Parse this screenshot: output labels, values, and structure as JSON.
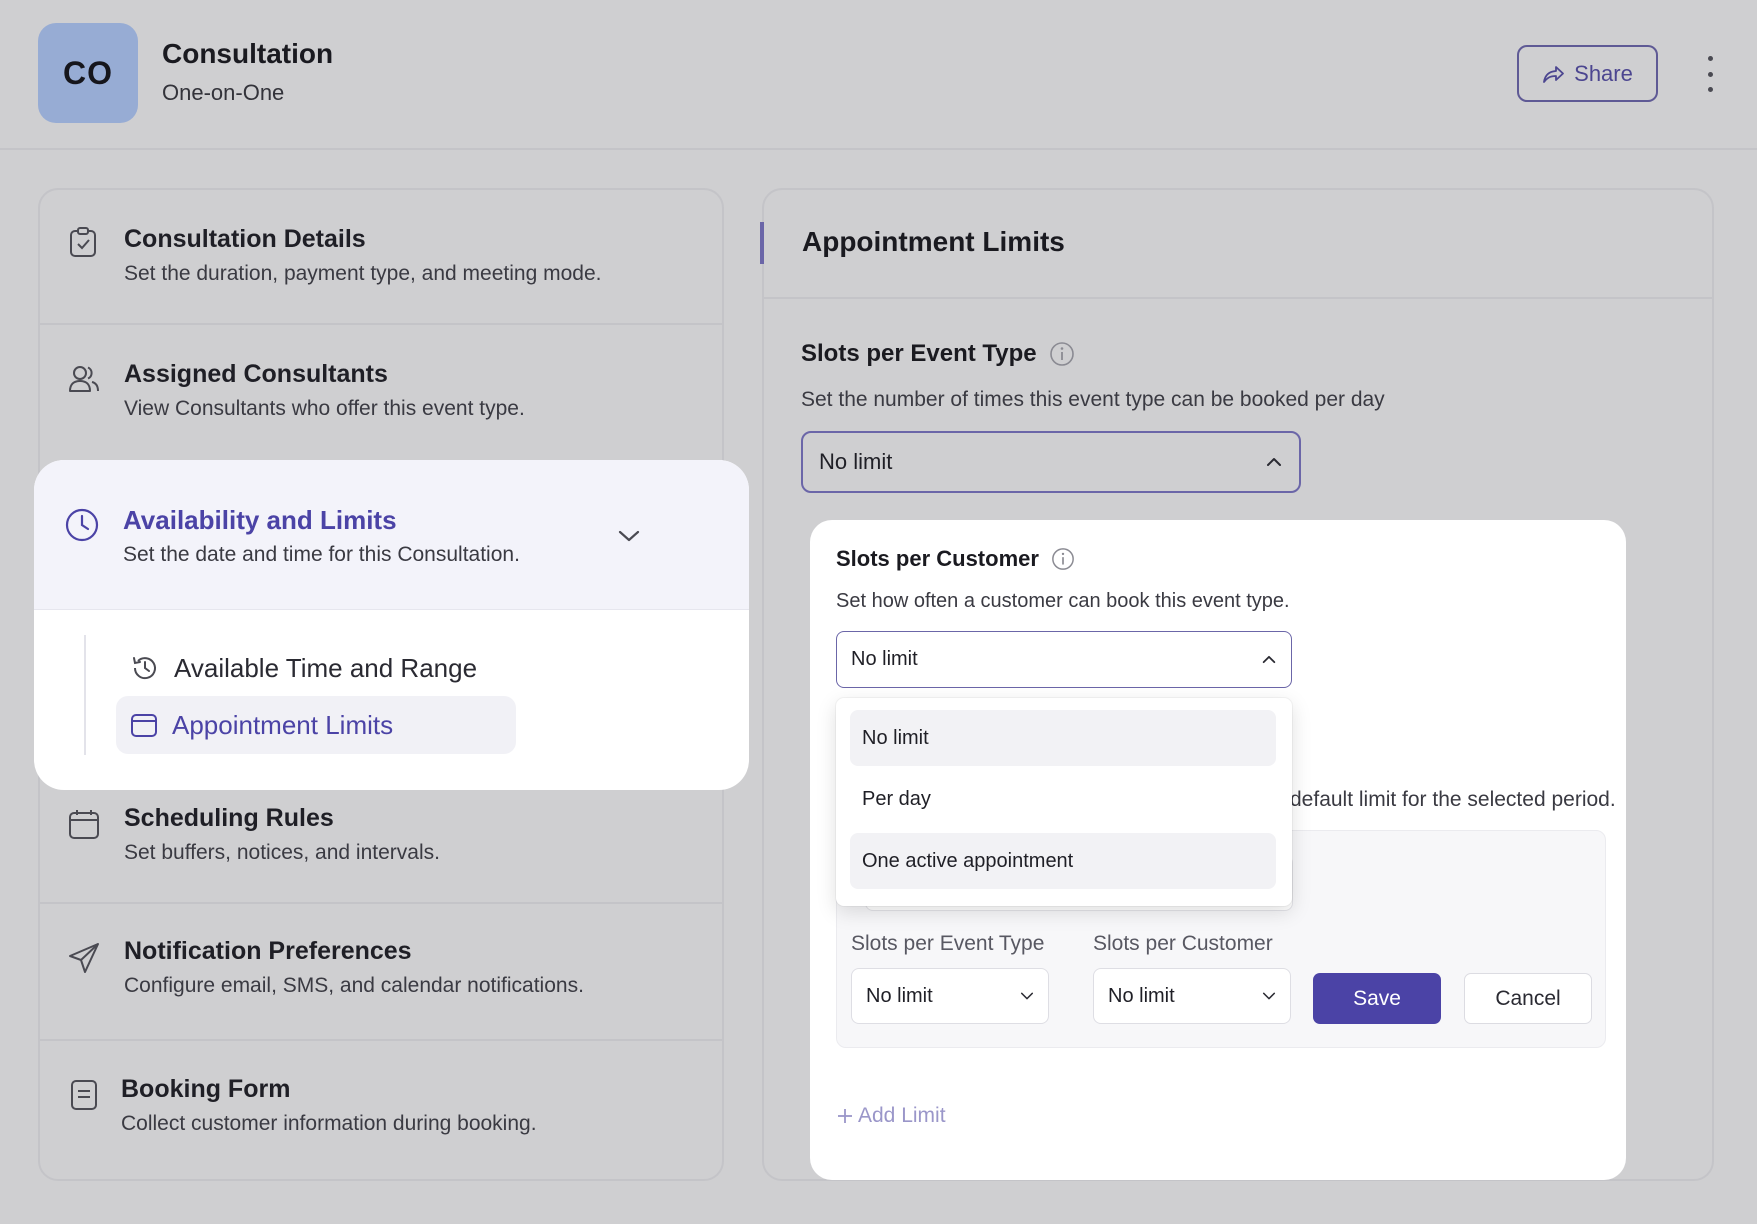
{
  "header": {
    "avatar_initials": "CO",
    "title": "Consultation",
    "subtitle": "One-on-One",
    "share_label": "Share"
  },
  "sidebar": {
    "items": [
      {
        "title": "Consultation Details",
        "desc": "Set the duration, payment type, and meeting mode.",
        "icon": "clipboard-check-icon"
      },
      {
        "title": "Assigned Consultants",
        "desc": "View Consultants who offer this event type.",
        "icon": "users-icon"
      },
      {
        "title": "Availability and Limits",
        "desc": "Set the date and time for this Consultation.",
        "icon": "clock-icon"
      },
      {
        "title": "Scheduling Rules",
        "desc": "Set buffers, notices, and intervals.",
        "icon": "calendar-icon"
      },
      {
        "title": "Notification Preferences",
        "desc": "Configure email, SMS, and calendar notifications.",
        "icon": "send-icon"
      },
      {
        "title": "Booking Form",
        "desc": "Collect customer information during booking.",
        "icon": "form-icon"
      }
    ],
    "sub_items": [
      {
        "label": "Available Time and Range",
        "icon": "history-clock-icon"
      },
      {
        "label": "Appointment Limits",
        "icon": "calendar-icon"
      }
    ]
  },
  "main": {
    "title": "Appointment Limits",
    "slots_event": {
      "title": "Slots per Event Type",
      "desc": "Set the number of times this event type can be booked per day",
      "value": "No limit"
    },
    "slots_customer": {
      "title": "Slots per Customer",
      "desc": "Set how often a customer can book this event type.",
      "value": "No limit",
      "options": [
        "No limit",
        "Per day",
        "One active appointment"
      ]
    },
    "partial_desc": "default limit for the selected period.",
    "limit_row": {
      "event_label": "Slots per Event Type",
      "event_value": "No limit",
      "customer_label": "Slots per Customer",
      "customer_value": "No limit",
      "save_label": "Save",
      "cancel_label": "Cancel"
    },
    "add_limit_label": "Add Limit"
  },
  "colors": {
    "accent": "#4b43a6",
    "background": "#cfcfd1",
    "avatar": "#97acd4"
  }
}
